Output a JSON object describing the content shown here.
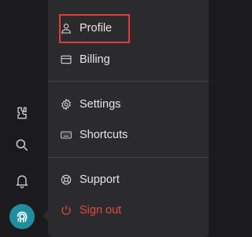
{
  "rail": {
    "icons": [
      {
        "name": "extensions-icon"
      },
      {
        "name": "search-icon"
      },
      {
        "name": "notifications-icon"
      }
    ],
    "avatar": {
      "name": "avatar"
    }
  },
  "menu": {
    "items": [
      {
        "label": "Profile",
        "icon": "user-icon"
      },
      {
        "label": "Billing",
        "icon": "credit-card-icon"
      },
      {
        "label": "Settings",
        "icon": "gear-icon"
      },
      {
        "label": "Shortcuts",
        "icon": "keyboard-icon"
      },
      {
        "label": "Support",
        "icon": "lifebuoy-icon"
      },
      {
        "label": "Sign out",
        "icon": "power-icon"
      }
    ]
  },
  "colors": {
    "highlight": "#e23a3a",
    "signout": "#e24a44",
    "avatar_bg": "#1f8f9e"
  }
}
